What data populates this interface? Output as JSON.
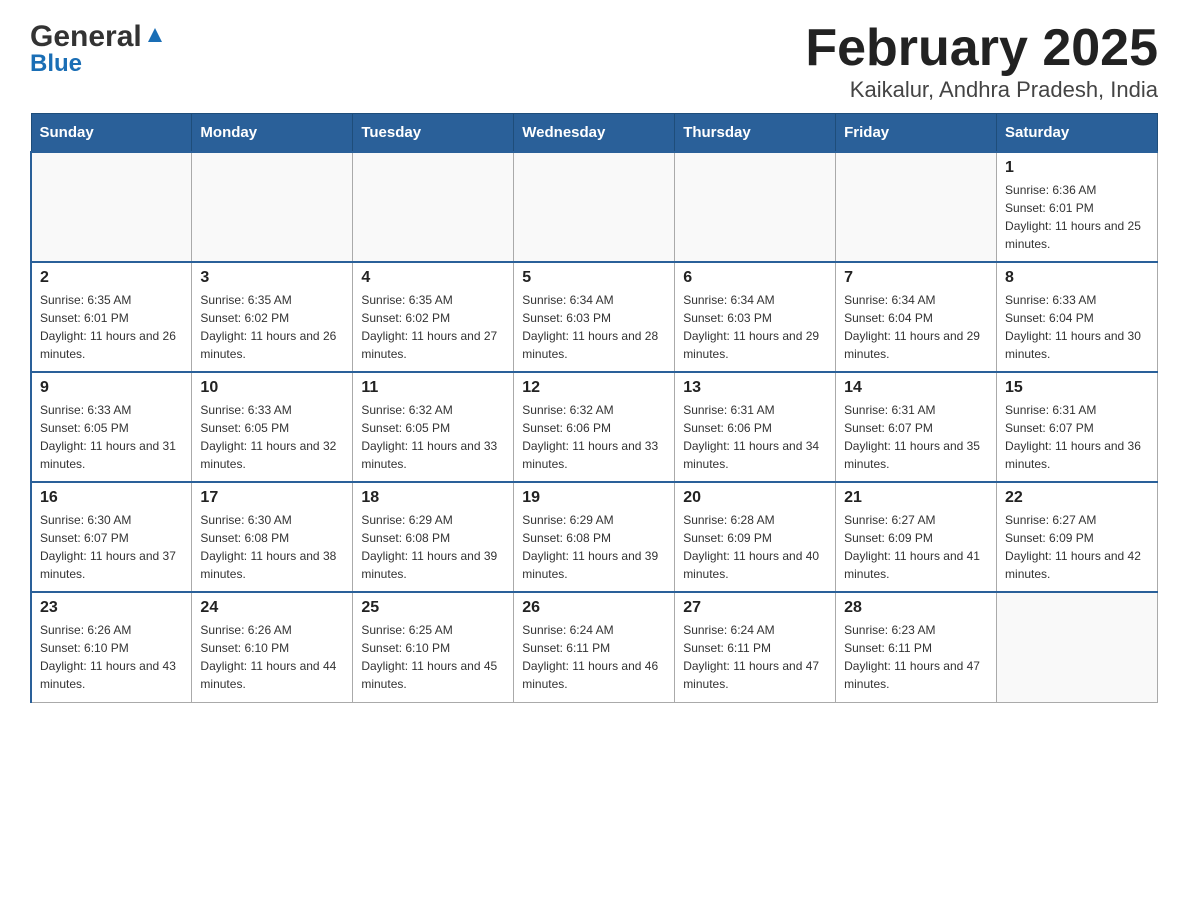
{
  "header": {
    "logo_general": "General",
    "logo_blue": "Blue",
    "title": "February 2025",
    "subtitle": "Kaikalur, Andhra Pradesh, India"
  },
  "days_of_week": [
    "Sunday",
    "Monday",
    "Tuesday",
    "Wednesday",
    "Thursday",
    "Friday",
    "Saturday"
  ],
  "weeks": [
    [
      {
        "day": "",
        "sunrise": "",
        "sunset": "",
        "daylight": ""
      },
      {
        "day": "",
        "sunrise": "",
        "sunset": "",
        "daylight": ""
      },
      {
        "day": "",
        "sunrise": "",
        "sunset": "",
        "daylight": ""
      },
      {
        "day": "",
        "sunrise": "",
        "sunset": "",
        "daylight": ""
      },
      {
        "day": "",
        "sunrise": "",
        "sunset": "",
        "daylight": ""
      },
      {
        "day": "",
        "sunrise": "",
        "sunset": "",
        "daylight": ""
      },
      {
        "day": "1",
        "sunrise": "Sunrise: 6:36 AM",
        "sunset": "Sunset: 6:01 PM",
        "daylight": "Daylight: 11 hours and 25 minutes."
      }
    ],
    [
      {
        "day": "2",
        "sunrise": "Sunrise: 6:35 AM",
        "sunset": "Sunset: 6:01 PM",
        "daylight": "Daylight: 11 hours and 26 minutes."
      },
      {
        "day": "3",
        "sunrise": "Sunrise: 6:35 AM",
        "sunset": "Sunset: 6:02 PM",
        "daylight": "Daylight: 11 hours and 26 minutes."
      },
      {
        "day": "4",
        "sunrise": "Sunrise: 6:35 AM",
        "sunset": "Sunset: 6:02 PM",
        "daylight": "Daylight: 11 hours and 27 minutes."
      },
      {
        "day": "5",
        "sunrise": "Sunrise: 6:34 AM",
        "sunset": "Sunset: 6:03 PM",
        "daylight": "Daylight: 11 hours and 28 minutes."
      },
      {
        "day": "6",
        "sunrise": "Sunrise: 6:34 AM",
        "sunset": "Sunset: 6:03 PM",
        "daylight": "Daylight: 11 hours and 29 minutes."
      },
      {
        "day": "7",
        "sunrise": "Sunrise: 6:34 AM",
        "sunset": "Sunset: 6:04 PM",
        "daylight": "Daylight: 11 hours and 29 minutes."
      },
      {
        "day": "8",
        "sunrise": "Sunrise: 6:33 AM",
        "sunset": "Sunset: 6:04 PM",
        "daylight": "Daylight: 11 hours and 30 minutes."
      }
    ],
    [
      {
        "day": "9",
        "sunrise": "Sunrise: 6:33 AM",
        "sunset": "Sunset: 6:05 PM",
        "daylight": "Daylight: 11 hours and 31 minutes."
      },
      {
        "day": "10",
        "sunrise": "Sunrise: 6:33 AM",
        "sunset": "Sunset: 6:05 PM",
        "daylight": "Daylight: 11 hours and 32 minutes."
      },
      {
        "day": "11",
        "sunrise": "Sunrise: 6:32 AM",
        "sunset": "Sunset: 6:05 PM",
        "daylight": "Daylight: 11 hours and 33 minutes."
      },
      {
        "day": "12",
        "sunrise": "Sunrise: 6:32 AM",
        "sunset": "Sunset: 6:06 PM",
        "daylight": "Daylight: 11 hours and 33 minutes."
      },
      {
        "day": "13",
        "sunrise": "Sunrise: 6:31 AM",
        "sunset": "Sunset: 6:06 PM",
        "daylight": "Daylight: 11 hours and 34 minutes."
      },
      {
        "day": "14",
        "sunrise": "Sunrise: 6:31 AM",
        "sunset": "Sunset: 6:07 PM",
        "daylight": "Daylight: 11 hours and 35 minutes."
      },
      {
        "day": "15",
        "sunrise": "Sunrise: 6:31 AM",
        "sunset": "Sunset: 6:07 PM",
        "daylight": "Daylight: 11 hours and 36 minutes."
      }
    ],
    [
      {
        "day": "16",
        "sunrise": "Sunrise: 6:30 AM",
        "sunset": "Sunset: 6:07 PM",
        "daylight": "Daylight: 11 hours and 37 minutes."
      },
      {
        "day": "17",
        "sunrise": "Sunrise: 6:30 AM",
        "sunset": "Sunset: 6:08 PM",
        "daylight": "Daylight: 11 hours and 38 minutes."
      },
      {
        "day": "18",
        "sunrise": "Sunrise: 6:29 AM",
        "sunset": "Sunset: 6:08 PM",
        "daylight": "Daylight: 11 hours and 39 minutes."
      },
      {
        "day": "19",
        "sunrise": "Sunrise: 6:29 AM",
        "sunset": "Sunset: 6:08 PM",
        "daylight": "Daylight: 11 hours and 39 minutes."
      },
      {
        "day": "20",
        "sunrise": "Sunrise: 6:28 AM",
        "sunset": "Sunset: 6:09 PM",
        "daylight": "Daylight: 11 hours and 40 minutes."
      },
      {
        "day": "21",
        "sunrise": "Sunrise: 6:27 AM",
        "sunset": "Sunset: 6:09 PM",
        "daylight": "Daylight: 11 hours and 41 minutes."
      },
      {
        "day": "22",
        "sunrise": "Sunrise: 6:27 AM",
        "sunset": "Sunset: 6:09 PM",
        "daylight": "Daylight: 11 hours and 42 minutes."
      }
    ],
    [
      {
        "day": "23",
        "sunrise": "Sunrise: 6:26 AM",
        "sunset": "Sunset: 6:10 PM",
        "daylight": "Daylight: 11 hours and 43 minutes."
      },
      {
        "day": "24",
        "sunrise": "Sunrise: 6:26 AM",
        "sunset": "Sunset: 6:10 PM",
        "daylight": "Daylight: 11 hours and 44 minutes."
      },
      {
        "day": "25",
        "sunrise": "Sunrise: 6:25 AM",
        "sunset": "Sunset: 6:10 PM",
        "daylight": "Daylight: 11 hours and 45 minutes."
      },
      {
        "day": "26",
        "sunrise": "Sunrise: 6:24 AM",
        "sunset": "Sunset: 6:11 PM",
        "daylight": "Daylight: 11 hours and 46 minutes."
      },
      {
        "day": "27",
        "sunrise": "Sunrise: 6:24 AM",
        "sunset": "Sunset: 6:11 PM",
        "daylight": "Daylight: 11 hours and 47 minutes."
      },
      {
        "day": "28",
        "sunrise": "Sunrise: 6:23 AM",
        "sunset": "Sunset: 6:11 PM",
        "daylight": "Daylight: 11 hours and 47 minutes."
      },
      {
        "day": "",
        "sunrise": "",
        "sunset": "",
        "daylight": ""
      }
    ]
  ]
}
